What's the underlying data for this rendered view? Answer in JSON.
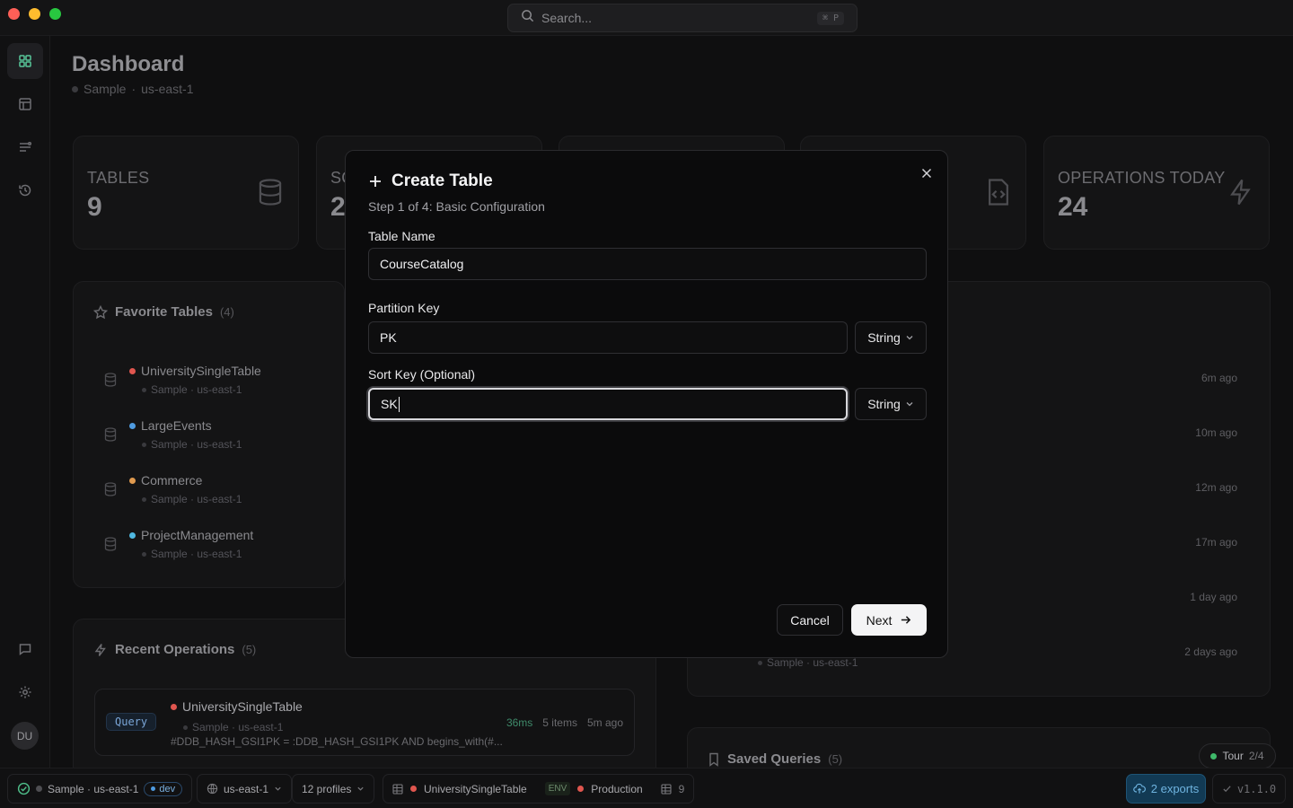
{
  "search": {
    "placeholder": "Search...",
    "shortcut": "⌘ P"
  },
  "header": {
    "title": "Dashboard",
    "connection": "Sample",
    "region": "us-east-1"
  },
  "stats": [
    {
      "label": "TABLES",
      "value": "9"
    },
    {
      "label": "SC",
      "value": "2"
    },
    {
      "label": "",
      "value": ""
    },
    {
      "label": "",
      "value": ""
    },
    {
      "label": "OPERATIONS TODAY",
      "value": "24"
    }
  ],
  "favorites": {
    "title": "Favorite Tables",
    "count": "(4)",
    "items": [
      {
        "name": "UniversitySingleTable",
        "color": "#e0564f",
        "meta": "Sample · us-east-1"
      },
      {
        "name": "LargeEvents",
        "color": "#4f9be0",
        "meta": "Sample · us-east-1"
      },
      {
        "name": "Commerce",
        "color": "#e09a4f",
        "meta": "Sample · us-east-1"
      },
      {
        "name": "ProjectManagement",
        "color": "#4fb8e0",
        "meta": "Sample · us-east-1"
      }
    ]
  },
  "activity": {
    "times": [
      "6m ago",
      "10m ago",
      "12m ago",
      "17m ago",
      "1 day ago",
      "2 days ago"
    ],
    "last_meta": "Sample · us-east-1"
  },
  "recent_ops": {
    "title": "Recent Operations",
    "count": "(5)",
    "first": {
      "badge": "Query",
      "table": "UniversitySingleTable",
      "meta": "Sample · us-east-1",
      "query": "#DDB_HASH_GSI1PK = :DDB_HASH_GSI1PK AND begins_with(#...",
      "duration": "36ms",
      "items": "5 items",
      "time": "5m ago"
    }
  },
  "saved_queries": {
    "title": "Saved Queries",
    "count": "(5)"
  },
  "modal": {
    "title": "Create Table",
    "step": "Step 1 of 4: Basic Configuration",
    "table_name_label": "Table Name",
    "table_name_value": "CourseCatalog",
    "partition_key_label": "Partition Key",
    "partition_key_value": "PK",
    "partition_key_type": "String",
    "sort_key_label": "Sort Key (Optional)",
    "sort_key_value": "SK",
    "sort_key_type": "String",
    "cancel": "Cancel",
    "next": "Next"
  },
  "tour": {
    "label": "Tour",
    "progress": "2/4"
  },
  "statusbar": {
    "connection": "Sample · us-east-1",
    "env_tag": "dev",
    "region": "us-east-1",
    "profiles": "12 profiles",
    "table": "UniversitySingleTable",
    "env_label": "ENV",
    "environment": "Production",
    "table_count": "9",
    "exports": "2 exports",
    "version": "v1.1.0"
  },
  "sidebar": {
    "avatar": "DU"
  },
  "colors": {
    "accent": "#58c79a",
    "primary_button": "#f4f4f5",
    "exports": "#123a54"
  }
}
